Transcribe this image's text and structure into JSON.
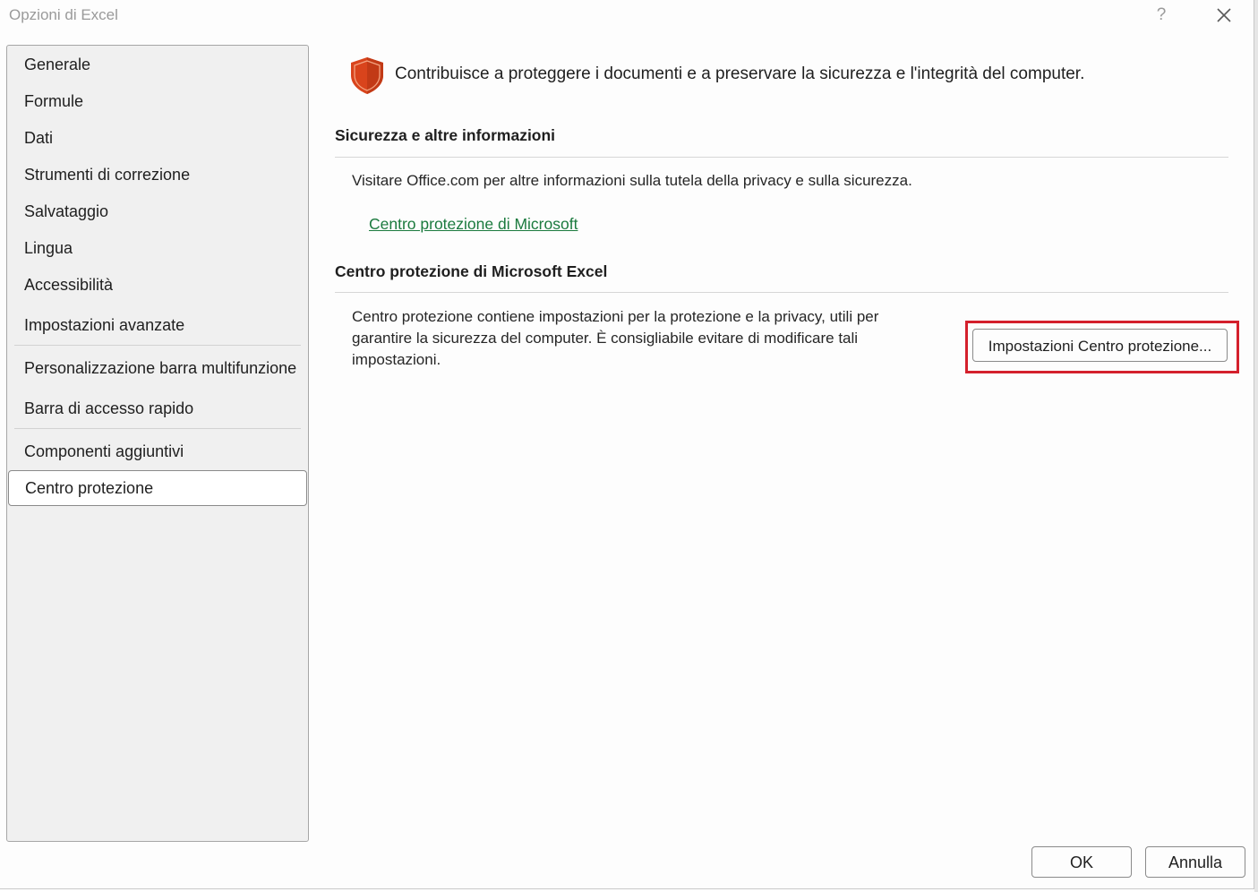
{
  "window": {
    "title": "Opzioni di Excel",
    "help_label": "?",
    "close_label": "✕"
  },
  "sidebar": {
    "items": [
      {
        "label": "Generale"
      },
      {
        "label": "Formule"
      },
      {
        "label": "Dati"
      },
      {
        "label": "Strumenti di correzione"
      },
      {
        "label": "Salvataggio"
      },
      {
        "label": "Lingua"
      },
      {
        "label": "Accessibilità"
      },
      {
        "label": "Impostazioni avanzate"
      },
      {
        "label": "Personalizzazione barra multifunzione"
      },
      {
        "label": "Barra di accesso rapido"
      },
      {
        "label": "Componenti aggiuntivi"
      },
      {
        "label": "Centro protezione",
        "selected": true
      }
    ]
  },
  "main": {
    "header_icon": "shield-icon",
    "header_text": "Contribuisce a proteggere i documenti e a preservare la sicurezza e l'integrità del computer.",
    "section1": {
      "title": "Sicurezza e altre informazioni",
      "text": "Visitare Office.com per altre informazioni sulla tutela della privacy e sulla sicurezza.",
      "link": "Centro protezione di Microsoft"
    },
    "section2": {
      "title": "Centro protezione di Microsoft Excel",
      "text": "Centro protezione contiene impostazioni per la protezione e la privacy, utili per garantire la sicurezza del computer. È consigliabile evitare di modificare tali impostazioni.",
      "button": "Impostazioni Centro protezione..."
    }
  },
  "footer": {
    "ok_label": "OK",
    "cancel_label": "Annulla"
  },
  "colors": {
    "shield": "#d9441c",
    "link": "#1b7a3e",
    "highlight": "#d4202c"
  }
}
